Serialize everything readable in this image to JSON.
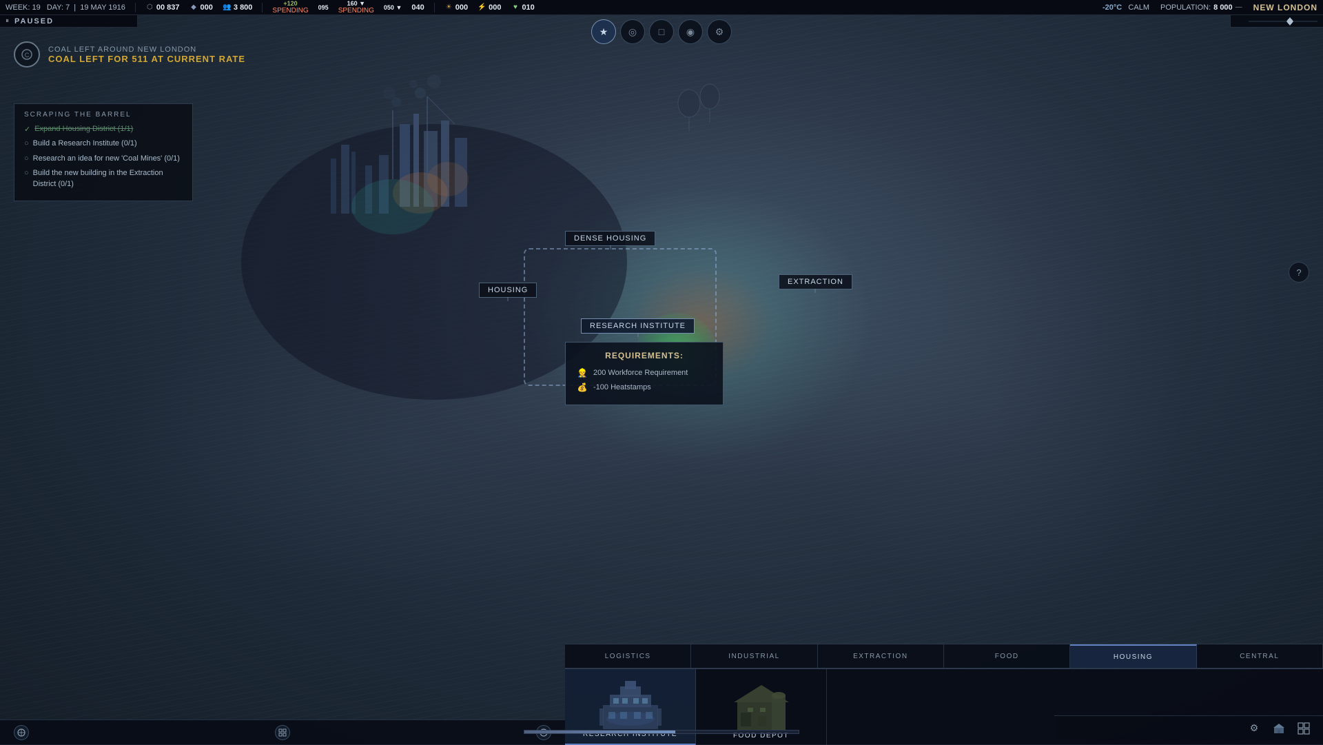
{
  "header": {
    "week": "WEEK: 19",
    "day": "DAY: 7",
    "date": "19 MAY 1916",
    "resources": {
      "coal_icon": "⬡",
      "coal_value": "00 837",
      "steel_icon": "◆",
      "steel_value": "000",
      "population_icon": "👥",
      "population_value": "3 800",
      "food_plus": "+120",
      "food_minus": "095",
      "resource_160": "160 ▼",
      "resource_050": "050 ▼",
      "resource_040": "040",
      "morale_icon": "☀",
      "morale_value": "000",
      "discord_icon": "⚡",
      "discord_value": "000",
      "health_icon": "♥",
      "health_value": "010"
    },
    "spending_labels": [
      "SPENDING",
      "SPENDING"
    ],
    "temperature": "-20°C",
    "weather": "CALM",
    "population_label": "POPULATION:",
    "population_count": "8 000",
    "city_name": "NEW LONDON"
  },
  "pause": {
    "icon": "⏸",
    "label": "PAUSED"
  },
  "nav_buttons": [
    {
      "id": "star",
      "symbol": "★",
      "active": true
    },
    {
      "id": "circle",
      "symbol": "◎",
      "active": false
    },
    {
      "id": "square",
      "symbol": "□",
      "active": false
    },
    {
      "id": "compass",
      "symbol": "◉",
      "active": false
    },
    {
      "id": "settings",
      "symbol": "⚙",
      "active": false
    }
  ],
  "coal_info": {
    "label": "COAL LEFT AROUND NEW LONDON",
    "rate_text": "COAL LEFT FOR 511 AT CURRENT RATE"
  },
  "quest": {
    "title": "SCRAPING THE BARREL",
    "items": [
      {
        "text": "Expand Housing District (1/1)",
        "completed": true
      },
      {
        "text": "Build a Research Institute (0/1)",
        "completed": false
      },
      {
        "text": "Research an idea for new 'Coal Mines' (0/1)",
        "completed": false
      },
      {
        "text": "Build the new building in the Extraction District (0/1)",
        "completed": false
      }
    ]
  },
  "map_labels": {
    "dense_housing": "DENSE HOUSING",
    "housing": "HOUSING",
    "extraction": "EXTRACTION",
    "research_institute": "RESEARCH INSTITUTE"
  },
  "requirements": {
    "title": "REQUIREMENTS:",
    "items": [
      {
        "icon": "👷",
        "text": "200 Workforce Requirement"
      },
      {
        "icon": "💰",
        "text": "-100 Heatstamps"
      }
    ]
  },
  "district_tabs": [
    {
      "id": "logistics",
      "label": "LOGISTICS",
      "active": false
    },
    {
      "id": "industrial",
      "label": "INDUSTRIAL",
      "active": false
    },
    {
      "id": "extraction",
      "label": "EXTRACTION",
      "active": false
    },
    {
      "id": "food",
      "label": "FOOD",
      "active": false
    },
    {
      "id": "housing",
      "label": "HOUSING",
      "active": true
    },
    {
      "id": "central",
      "label": "CENTRAL",
      "active": false
    }
  ],
  "building_cards": [
    {
      "id": "research-institute",
      "name": "RESEARCH INSTITUTE",
      "selected": true
    },
    {
      "id": "food-depot",
      "name": "FOOD DEPOT",
      "selected": false
    }
  ],
  "bottom_toolbar": {
    "icon1": "⊙",
    "icon2": "⬜",
    "icon3": "⊕"
  },
  "bottom_right": {
    "settings_icon": "⚙",
    "map_icon": "⊞",
    "grid_icon": "⊟"
  },
  "progress": {
    "fill_percent": 55
  }
}
